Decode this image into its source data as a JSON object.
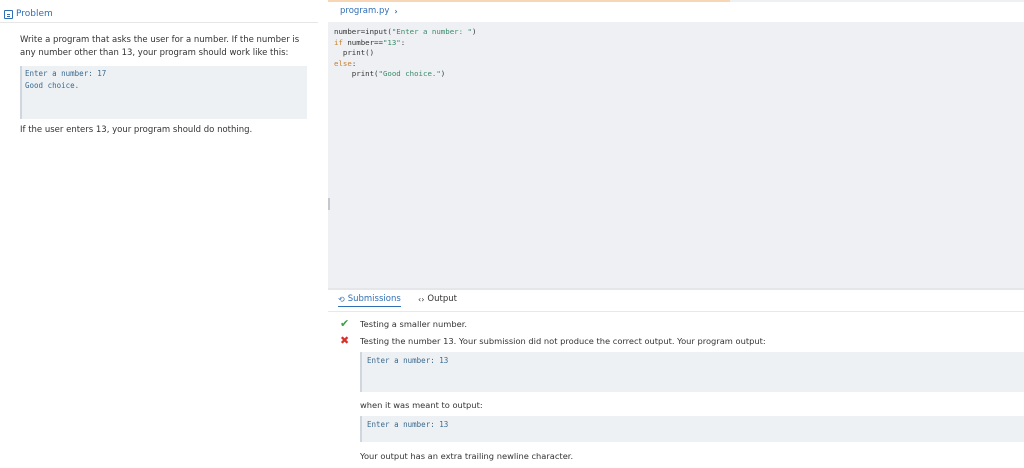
{
  "problem": {
    "tab_label": "Problem",
    "text": "Write a program that asks the user for a number. If the number is any number other than 13, your program should work like this:",
    "example_lines": [
      "Enter a number: 17",
      "Good choice."
    ],
    "note": "If the user enters 13, your program should do nothing."
  },
  "editor": {
    "file_tab": "program.py",
    "chevron": "›",
    "code": {
      "l1_a": "number=input(",
      "l1_str": "\"Enter a number: \"",
      "l1_b": ")",
      "l2_kw": "if",
      "l2_a": " number==",
      "l2_str": "\"13\"",
      "l2_b": ":",
      "l3": "  print()",
      "l4_kw": "else",
      "l4_b": ":",
      "l5_a": "    print(",
      "l5_str": "\"Good choice.\"",
      "l5_b": ")"
    }
  },
  "results": {
    "tabs": {
      "submissions": "Submissions",
      "output": "Output"
    },
    "rows": [
      {
        "status": "pass",
        "text": "Testing a smaller number."
      },
      {
        "status": "fail",
        "text": "Testing the number 13. Your submission did not produce the correct output. Your program output:"
      }
    ],
    "program_output": "Enter a number: 13",
    "expected_label": "when it was meant to output:",
    "expected_output": "Enter a number: 13",
    "hint": "Your output has an extra trailing newline character."
  },
  "colors": {
    "accent": "#2f6fb5",
    "pass": "#3aa04a",
    "fail": "#d9302c",
    "code_bg": "#eef1f4"
  }
}
